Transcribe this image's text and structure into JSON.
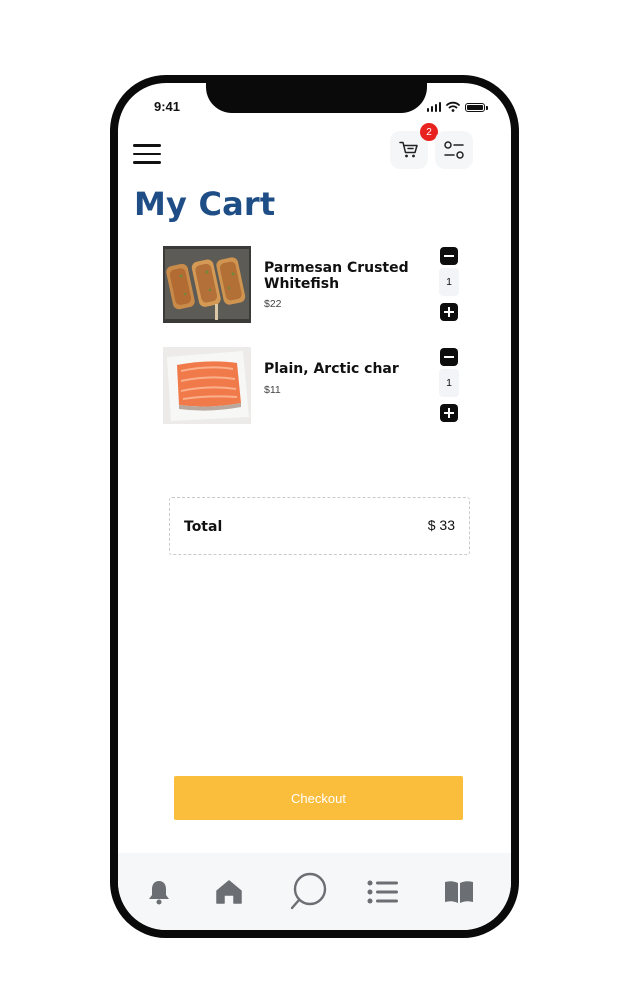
{
  "status_bar": {
    "time": "9:41"
  },
  "header": {
    "menu_icon": "hamburger-menu-icon",
    "cart_icon": "shopping-cart-icon",
    "cart_badge_count": "2",
    "filter_icon": "sliders-icon"
  },
  "page": {
    "title": "My Cart"
  },
  "cart": {
    "items": [
      {
        "name": "Parmesan Crusted Whitefish",
        "price": "$22",
        "quantity": "1"
      },
      {
        "name": "Plain, Arctic char",
        "price": "$11",
        "quantity": "1"
      }
    ],
    "total_label": "Total",
    "total_value": "$ 33"
  },
  "checkout": {
    "label": "Checkout"
  },
  "tab_bar": {
    "tabs": [
      {
        "icon": "bell-icon"
      },
      {
        "icon": "home-icon"
      },
      {
        "icon": "chat-bubble-icon"
      },
      {
        "icon": "list-icon"
      },
      {
        "icon": "book-icon"
      }
    ]
  },
  "colors": {
    "title": "#1f4e87",
    "checkout_button": "#fbbd3c",
    "badge": "#e8231f",
    "stepper": "#0d0d0d",
    "tab_icon": "#6b6e72"
  }
}
